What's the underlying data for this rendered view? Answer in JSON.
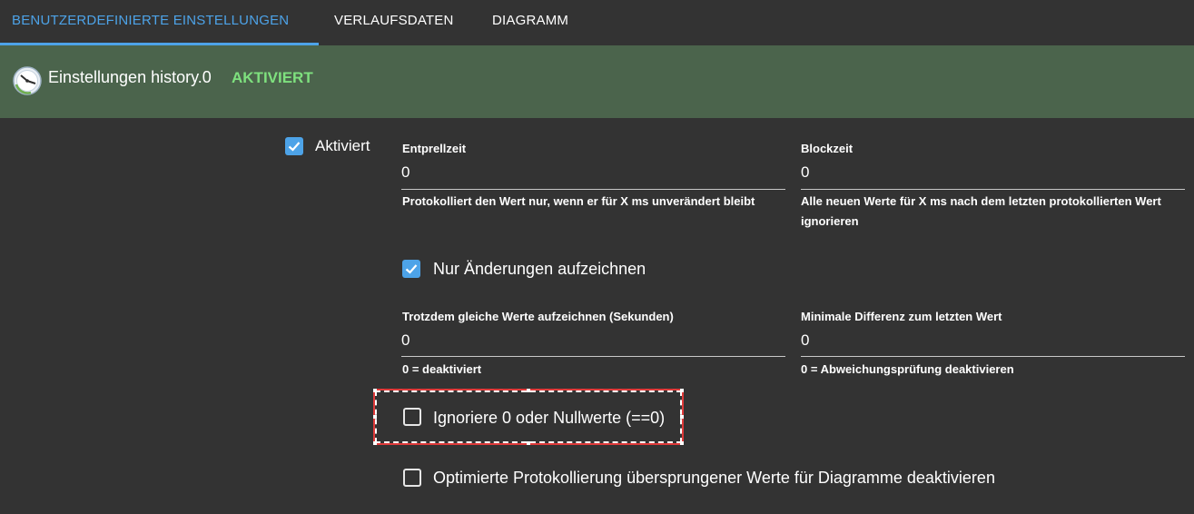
{
  "tabs": [
    {
      "label": "BENUTZERDEFINIERTE EINSTELLUNGEN",
      "active": true
    },
    {
      "label": "VERLAUFSDATEN",
      "active": false
    },
    {
      "label": "DIAGRAMM",
      "active": false
    }
  ],
  "header": {
    "title": "Einstellungen history.0",
    "status": "AKTIVIERT",
    "icon": "clock-history-icon"
  },
  "settings": {
    "activated": {
      "label": "Aktiviert",
      "checked": true
    },
    "debounce": {
      "label": "Entprellzeit",
      "value": "0",
      "help": "Protokolliert den Wert nur, wenn er für X ms unverändert bleibt"
    },
    "blocktime": {
      "label": "Blockzeit",
      "value": "0",
      "help_line1": "Alle neuen Werte für X ms nach dem letzten protokollierten Wert",
      "help_line2": "ignorieren"
    },
    "changes_only": {
      "label": "Nur Änderungen aufzeichnen",
      "checked": true
    },
    "change_interval": {
      "label": "Trotzdem gleiche Werte aufzeichnen (Sekunden)",
      "value": "0",
      "help": "0 = deaktiviert"
    },
    "min_diff": {
      "label": "Minimale Differenz zum letzten Wert",
      "value": "0",
      "help": "0 = Abweichungsprüfung deaktivieren"
    },
    "ignore_zero": {
      "label": "Ignoriere 0 oder Nullwerte (==0)",
      "checked": false
    },
    "disable_skipped": {
      "label": "Optimierte Protokollierung übersprungener Werte für Diagramme deaktivieren",
      "checked": false
    }
  },
  "colors": {
    "accent": "#4da3e8",
    "header_bg": "#4b644c",
    "status_green": "#7ee07e",
    "background": "#333333"
  }
}
